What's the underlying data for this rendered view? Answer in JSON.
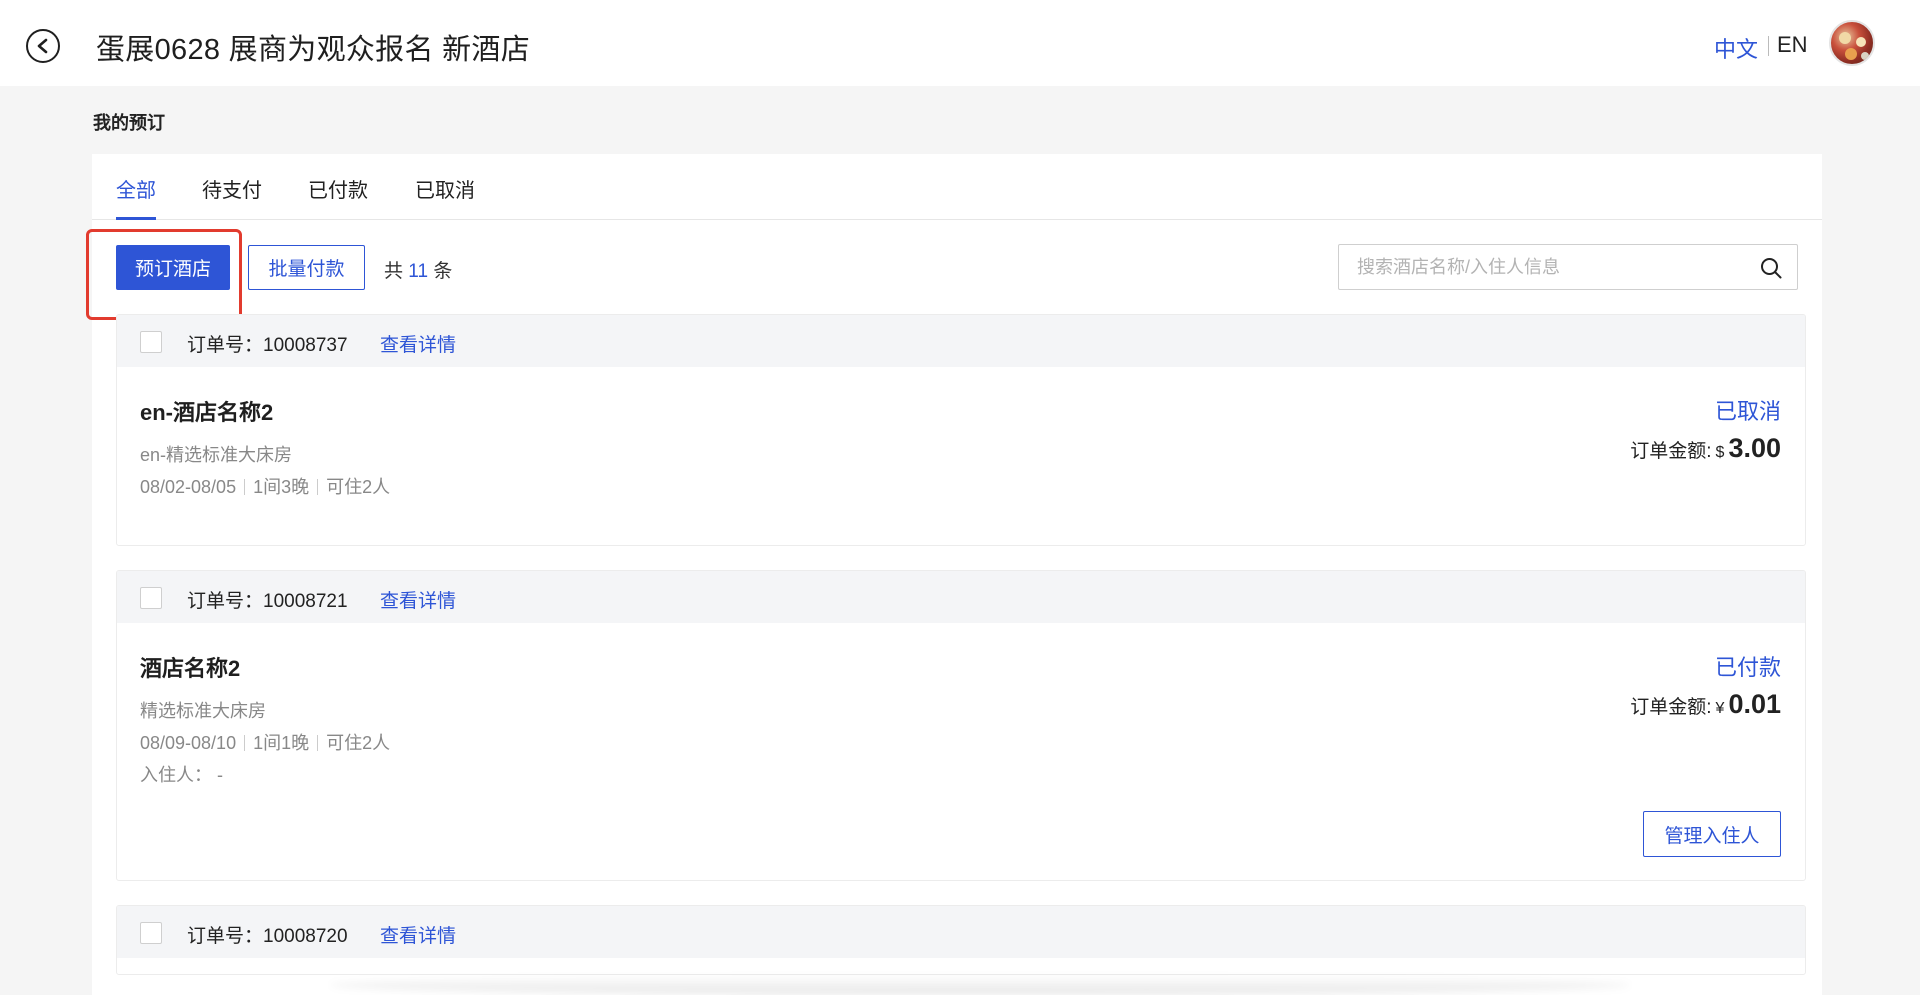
{
  "header": {
    "title": "蛋展0628 展商为观众报名 新酒店",
    "lang_zh": "中文",
    "lang_en": "EN"
  },
  "section": {
    "title": "我的预订"
  },
  "tabs": [
    {
      "label": "全部",
      "active": true
    },
    {
      "label": "待支付",
      "active": false
    },
    {
      "label": "已付款",
      "active": false
    },
    {
      "label": "已取消",
      "active": false
    }
  ],
  "toolbar": {
    "book_label": "预订酒店",
    "batch_pay_label": "批量付款",
    "total_prefix": "共",
    "total_count": "11",
    "total_suffix": "条"
  },
  "search": {
    "placeholder": "搜索酒店名称/入住人信息"
  },
  "orders": [
    {
      "order_no": "订单号：10008737",
      "detail_label": "查看详情",
      "hotel": "en-酒店名称2",
      "room": "en-精选标准大床房",
      "dates": "08/02-08/05",
      "rooms_nights": "1间3晚",
      "capacity": "可住2人",
      "status": "已取消",
      "amount_label": "订单金额:",
      "currency": "$",
      "amount": "3.00"
    },
    {
      "order_no": "订单号：10008721",
      "detail_label": "查看详情",
      "hotel": "酒店名称2",
      "room": "精选标准大床房",
      "dates": "08/09-08/10",
      "rooms_nights": "1间1晚",
      "capacity": "可住2人",
      "guest": "入住人：  -",
      "status": "已付款",
      "amount_label": "订单金额:",
      "currency": "¥",
      "amount": "0.01",
      "manage_label": "管理入住人"
    },
    {
      "order_no": "订单号：10008720",
      "detail_label": "查看详情"
    }
  ],
  "colors": {
    "accent": "#2e55d6",
    "highlight": "#e23b2e"
  }
}
